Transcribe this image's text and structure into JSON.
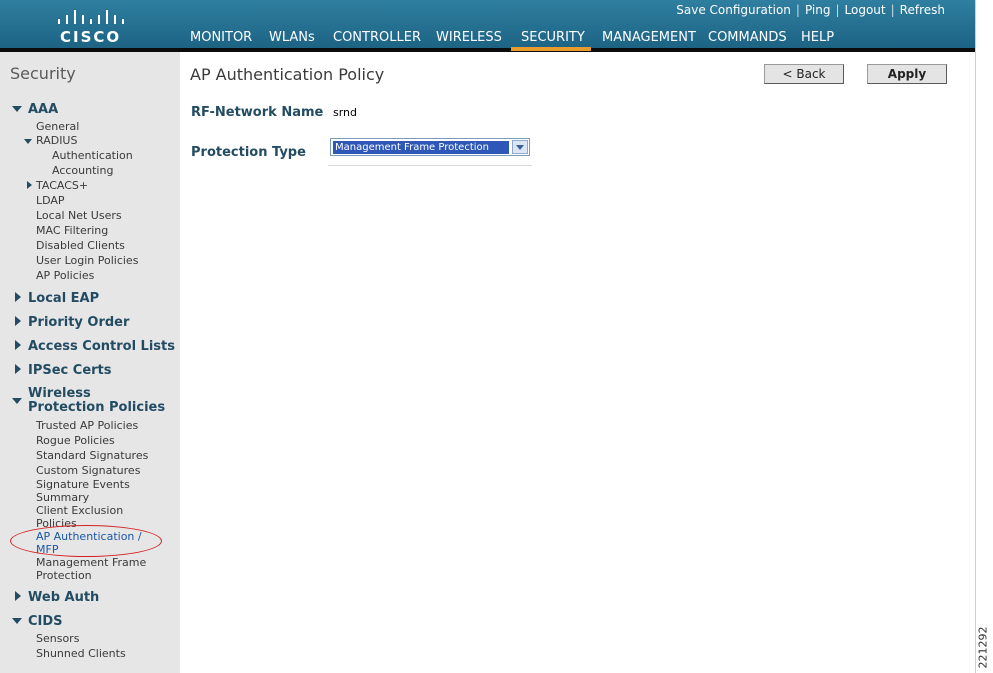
{
  "brand": {
    "logo_text": "CISCO"
  },
  "top_links": [
    "Save Configuration",
    "Ping",
    "Logout",
    "Refresh"
  ],
  "main_nav": [
    "MONITOR",
    "WLANs",
    "CONTROLLER",
    "WIRELESS",
    "SECURITY",
    "MANAGEMENT",
    "COMMANDS",
    "HELP"
  ],
  "active_nav": "SECURITY",
  "sidebar": {
    "title": "Security",
    "aaa": {
      "label": "AAA",
      "general": "General",
      "radius": "RADIUS",
      "authentication": "Authentication",
      "accounting": "Accounting",
      "tacacs": "TACACS+",
      "ldap": "LDAP",
      "local_net_users": "Local Net Users",
      "mac_filtering": "MAC Filtering",
      "disabled_clients": "Disabled Clients",
      "user_login_policies": "User Login Policies",
      "ap_policies": "AP Policies"
    },
    "local_eap": "Local EAP",
    "priority_order": "Priority Order",
    "access_control_lists": "Access Control Lists",
    "ipsec_certs": "IPSec Certs",
    "wireless_protection": {
      "label": "Wireless Protection Policies",
      "trusted_ap_policies": "Trusted AP Policies",
      "rogue_policies": "Rogue Policies",
      "standard_signatures": "Standard Signatures",
      "custom_signatures": "Custom Signatures",
      "signature_events_summary": "Signature Events Summary",
      "client_exclusion_policies": "Client Exclusion Policies",
      "ap_authentication_mfp": "AP Authentication / MFP",
      "management_frame_protection": "Management Frame Protection"
    },
    "web_auth": "Web Auth",
    "cids": {
      "label": "CIDS",
      "sensors": "Sensors",
      "shunned_clients": "Shunned Clients"
    }
  },
  "content": {
    "title": "AP Authentication Policy",
    "back_label": "< Back",
    "apply_label": "Apply",
    "rf_network_name_label": "RF-Network Name",
    "rf_network_name_value": "srnd",
    "protection_type_label": "Protection Type",
    "protection_type_value": "Management Frame Protection"
  },
  "figure_id": "221292",
  "colors": {
    "header": "#1f6a8a",
    "active_tab_underline": "#e89a2d",
    "sidebar_bg": "#e6e6e6",
    "label_blue": "#234c63",
    "highlight_ellipse": "#d42222"
  }
}
